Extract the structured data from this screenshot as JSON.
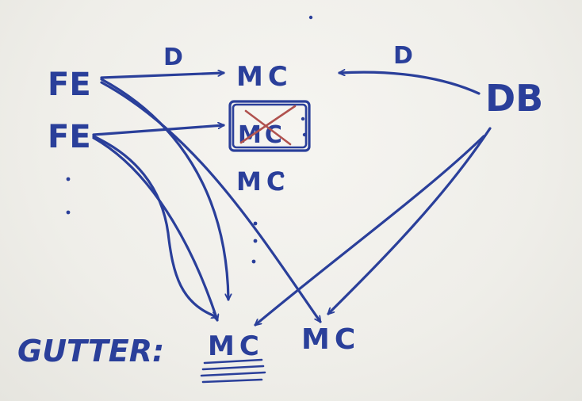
{
  "nodes": {
    "fe_top": "FE",
    "fe_bottom": "FE",
    "mc_top": "MC",
    "mc_failed": "MC",
    "mc_replacement": "MC",
    "db": "DB",
    "gutter_label": "GUTTER:",
    "mc_gutter_left": "MC",
    "mc_gutter_right": "MC"
  },
  "edge_labels": {
    "fe_to_mc": "D",
    "db_to_mc": "D"
  },
  "colors": {
    "ink": "#2a3f9a",
    "cross_out": "#b0524e",
    "board": "#f1f0ec"
  }
}
